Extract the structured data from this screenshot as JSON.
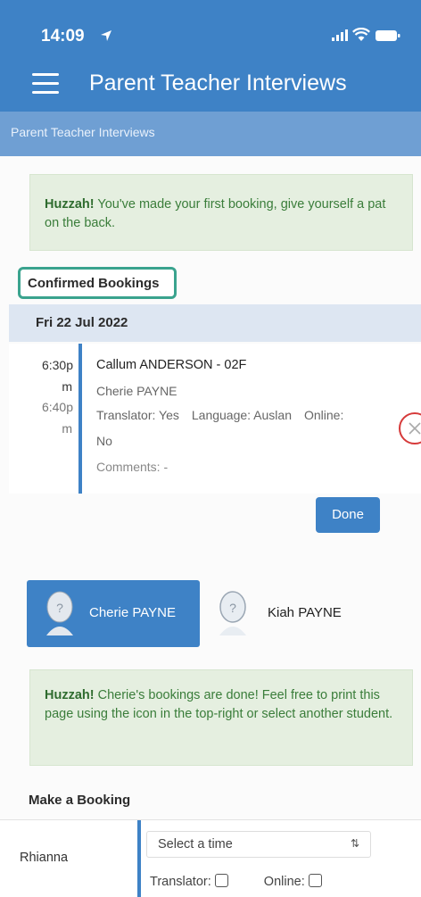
{
  "status_bar": {
    "time": "14:09"
  },
  "header": {
    "title": "Parent Teacher Interviews"
  },
  "breadcrumb": "Parent Teacher Interviews",
  "alert_first": {
    "strong": "Huzzah!",
    "text": " You've made your first booking, give yourself a pat on the back."
  },
  "confirmed": {
    "label": "Confirmed Bookings",
    "date": "Fri 22 Jul 2022",
    "booking": {
      "start_line1": "6:30p",
      "start_line2": "m",
      "end_line1": "6:40p",
      "end_line2": "m",
      "student": "Callum ANDERSON - 02F",
      "teacher": "Cherie PAYNE",
      "translator": "Translator: Yes",
      "language": "Language: Auslan",
      "online_label": "Online:",
      "online_value": "No",
      "comments": "Comments: -"
    },
    "done_label": "Done"
  },
  "students": [
    {
      "name": "Cherie PAYNE",
      "active": true
    },
    {
      "name": "Kiah PAYNE",
      "active": false
    }
  ],
  "alert_done": {
    "strong": "Huzzah!",
    "text": " Cherie's bookings are done! Feel free to print this page using the icon in the top-right or select another student."
  },
  "make_booking": {
    "title": "Make a Booking",
    "student": "Rhianna",
    "select_placeholder": "Select a time",
    "translator_label": "Translator:",
    "online_label": "Online:"
  },
  "colors": {
    "header": "#3e82c6",
    "breadcrumb": "#6f9fd3",
    "alert_bg": "#e5efe0",
    "highlight": "#3aa38e",
    "cancel": "#d63a3a"
  }
}
